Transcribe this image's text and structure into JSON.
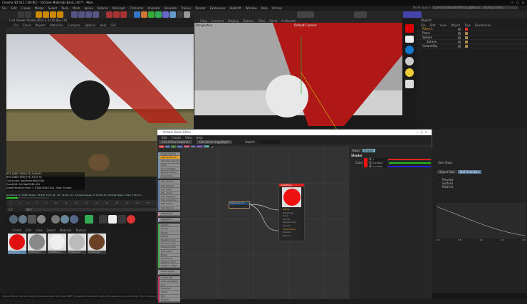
{
  "app": {
    "title": "Cinema 4D S22.118 (RC) - [Octane Materials Basic.c4d *] - Main",
    "node_space_label": "Node Space:",
    "node_space_value": "Current (Standard/Physical)",
    "layout_label": "Layout:",
    "layout_value": "Startup (User)"
  },
  "main_menu": [
    "File",
    "Edit",
    "Create",
    "Modes",
    "Select",
    "Tools",
    "Mesh",
    "Spline",
    "Volume",
    "MoGraph",
    "Character",
    "Animate",
    "Simulate",
    "Tracker",
    "Render",
    "Extensions",
    "Redshift",
    "Window",
    "Help",
    "Octane"
  ],
  "live_viewer": {
    "title": "Live Viewer Studio 2022.1.6 [16 Bay 19]",
    "menu": [
      "File",
      "Cloud",
      "Objects",
      "Materials",
      "Compare",
      "Options",
      "Help",
      "GUI"
    ],
    "stats": [
      "RTX 2080 Ti(P0)*(73)  %/50  63",
      "RTX 2080 Ti(P0)*(73)  %/72  70",
      "Out-of-core used/max:0Kb/20Gb",
      "Grey8/16: 0/0   Rgb32/64: 0/1",
      "Used/free/total mem: 2.7Gb/8.8Gb/11Gb  _Spot: Sunken"
    ],
    "rendering_line": "Rendering: 27.098%  Ms/sec: 86.848  Time: 00 : 00 : 01/00 : 00 : 04  Spp/maxspp: 271/1000  Tri: 20k/20k  Mesh: 5  Hair: 0  RTX:on",
    "progress": 0.27
  },
  "viewport": {
    "menu": [
      "View",
      "Cameras",
      "Display",
      "Options",
      "Filter",
      "Panel",
      "ProRender"
    ],
    "label": "Perspective",
    "camera": "Default Camera"
  },
  "objects": {
    "title": "Objects",
    "menu": [
      "File",
      "Edit",
      "View",
      "Object",
      "Tags",
      "Bookmarks"
    ],
    "items": [
      "Plane.1",
      "Plane",
      "Sphere",
      "Sphere",
      "OctaneSky"
    ]
  },
  "timeline": {
    "ticks": [
      "0",
      "2",
      "4",
      "6",
      "8",
      "10",
      "12",
      "14",
      "16",
      "18",
      "20",
      "22",
      "24",
      "26",
      "28",
      "30",
      "32",
      "34",
      "36"
    ],
    "start": "0 F",
    "end": "90 F"
  },
  "materials": {
    "menu": [
      "Create",
      "Edit",
      "View",
      "Select",
      "Material",
      "Texture"
    ],
    "items": [
      {
        "name": "OctDiffuse",
        "color": "#e01010"
      },
      {
        "name": "OctGlossy1",
        "color": "#888"
      },
      {
        "name": "OctDiffuse1",
        "color": "#eee"
      },
      {
        "name": "OctGlossy2",
        "color": "#bbb"
      },
      {
        "name": "OctGlossy3",
        "color": "#6b4226"
      }
    ]
  },
  "status": {
    "label": "Octane:",
    "text": "Move: Click and drag to move elements. Hold down SHIFT to quantize movement / add to the selection in point mode, CTRL to remove."
  },
  "node_editor": {
    "title": "Octane Node Editor",
    "menu": [
      "Edit",
      "Create",
      "View",
      "Help"
    ],
    "buttons": [
      "Get Active material",
      "Get Active tag/object"
    ],
    "search_label": "Search",
    "tabs": [
      {
        "l": "Mat",
        "c": "#b33"
      },
      {
        "l": "Tex",
        "c": "#357"
      },
      {
        "l": "Gen",
        "c": "#363"
      },
      {
        "l": "Map",
        "c": "#348"
      },
      {
        "l": "Misc",
        "c": "#a35"
      },
      {
        "l": "Emi",
        "c": "#447"
      },
      {
        "l": "Med",
        "c": "#539"
      },
      {
        "l": "C4D",
        "c": "#388"
      },
      {
        "l": "All",
        "c": "#111"
      }
    ],
    "list_groups": [
      [
        "Image texture",
        "RGB spectrum",
        "Gaussian spectrum",
        "Float",
        "W Coordinate",
        "Baking texture",
        "Image tiles"
      ],
      [
        "OSL texture",
        "OSL Camera",
        "OSL Delay",
        "OSL Scene",
        "OSL Mapping",
        "OSL projection",
        "OSL Vector",
        "OSL Volume"
      ],
      [
        "Instantiate"
      ],
      [
        "Projection"
      ],
      [
        "Checks",
        "Clamp",
        "Falloff",
        "Marble",
        "Random color",
        "Random color",
        "Ridged fractal",
        "Sine wave",
        "Noise",
        "Turbulence",
        "Instance color",
        "Instance range"
      ],
      [
        "Curve range"
      ],
      [
        "Cosine Mix",
        "Color correction",
        "Dirt",
        "Gradient",
        "Invert",
        "Mix",
        "Multiply"
      ]
    ],
    "nodes": {
      "rgb": "RgbSpectrum",
      "mat": "OctDiffuse",
      "pins": [
        "Diffuse",
        "Roughness",
        "Bump",
        "Normal",
        "Displacement",
        "Opacity",
        "Transmission",
        "Emission",
        "Medium"
      ]
    },
    "shader": {
      "tabs": [
        "Basic",
        "Shader"
      ],
      "heading": "Shader",
      "color_label": "Color",
      "channels": [
        {
          "l": "R",
          "v": "1",
          "c": "#d22"
        },
        {
          "l": "G",
          "v": "0.016821",
          "c": "#2b2"
        },
        {
          "l": "B",
          "v": "0.016821",
          "c": "#22d"
        }
      ]
    }
  },
  "attributes": {
    "mode": "User Data",
    "tabs": [
      "Object Size",
      "Soft Selection"
    ],
    "fields": [
      "Preview",
      "Surface",
      "Restrict"
    ],
    "axis": [
      "0.0",
      "0.5",
      "1.0",
      "1.5",
      "2.0"
    ]
  }
}
